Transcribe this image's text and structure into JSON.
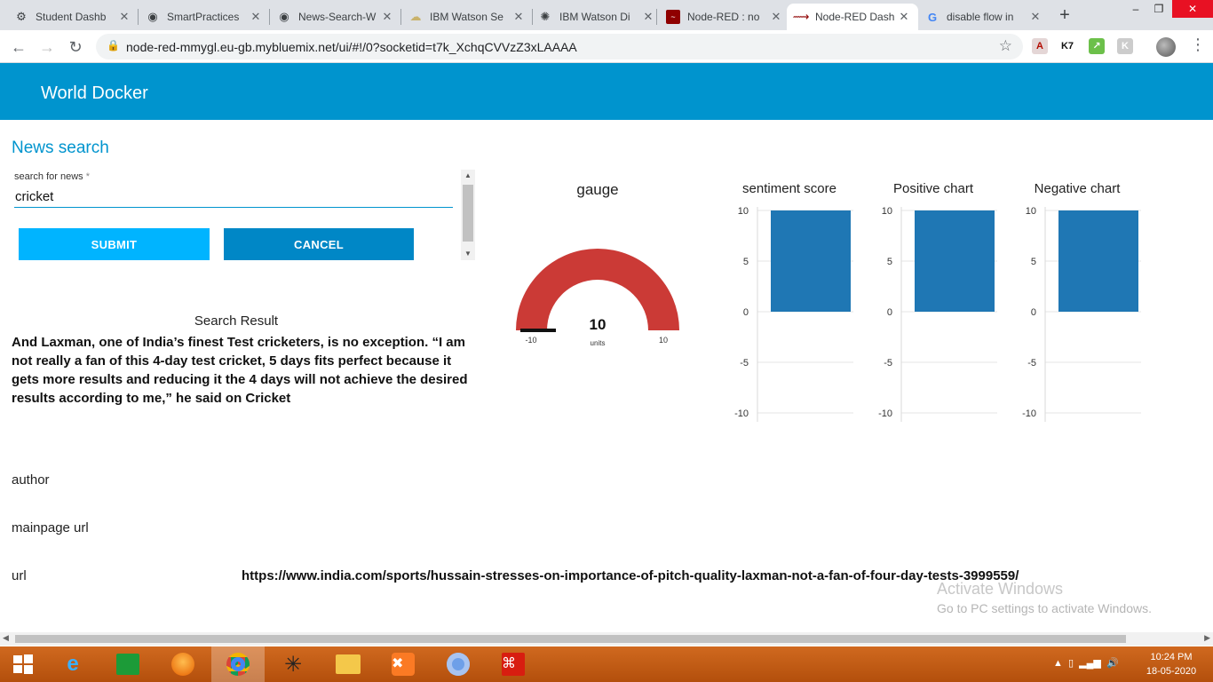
{
  "browser": {
    "tabs": [
      {
        "label": "Student Dashb",
        "icon": "gear-icon"
      },
      {
        "label": "SmartPractices",
        "icon": "github-icon"
      },
      {
        "label": "News-Search-W",
        "icon": "github-icon"
      },
      {
        "label": "IBM Watson Se",
        "icon": "cloud-icon"
      },
      {
        "label": "IBM Watson Di",
        "icon": "watson-icon"
      },
      {
        "label": "Node-RED : no",
        "icon": "node-red-icon"
      },
      {
        "label": "Node-RED Dash",
        "icon": "node-red-icon"
      },
      {
        "label": "disable flow in",
        "icon": "google-icon"
      }
    ],
    "active_tab": 6,
    "url": "node-red-mmygl.eu-gb.mybluemix.net/ui/#!/0?socketid=t7k_XchqCVVzZ3xLAAAA"
  },
  "dashboard": {
    "title": "World Docker",
    "group_title": "News search",
    "search_label": "search for news",
    "search_required": "*",
    "search_value": "cricket",
    "submit_label": "SUBMIT",
    "cancel_label": "CANCEL",
    "result_title": "Search Result",
    "result_text": "And Laxman, one of India’s finest Test cricketers, is no exception. “I am not really a fan of this 4-day test cricket, 5 days fits perfect because it gets more results and reducing it the 4 days will not achieve the desired results according to me,” he said on Cricket",
    "author_label": "author",
    "mainpage_label": "mainpage url",
    "url_label": "url",
    "url_value": "https://www.india.com/sports/hussain-stresses-on-importance-of-pitch-quality-laxman-not-a-fan-of-four-day-tests-3999559/"
  },
  "gauge": {
    "title": "gauge",
    "value": 10,
    "value_text": "10",
    "units": "units",
    "min": -10,
    "max": 10,
    "min_label": "-10",
    "max_label": "10",
    "color": "#cb3a36"
  },
  "chart_data": [
    {
      "type": "bar",
      "title": "sentiment score",
      "values": [
        10
      ],
      "ylim": [
        -10,
        10
      ],
      "yticks": [
        "10",
        "5",
        "0",
        "-5",
        "-10"
      ],
      "color": "#1f77b4"
    },
    {
      "type": "bar",
      "title": "Positive chart",
      "values": [
        10
      ],
      "ylim": [
        -10,
        10
      ],
      "yticks": [
        "10",
        "5",
        "0",
        "-5",
        "-10"
      ],
      "color": "#1f77b4"
    },
    {
      "type": "bar",
      "title": "Negative chart",
      "values": [
        10
      ],
      "ylim": [
        -10,
        10
      ],
      "yticks": [
        "10",
        "5",
        "0",
        "-5",
        "-10"
      ],
      "color": "#1f77b4"
    }
  ],
  "watermark": {
    "line1": "Activate Windows",
    "line2": "Go to PC settings to activate Windows."
  },
  "taskbar": {
    "time": "10:24 PM",
    "date": "18-05-2020"
  }
}
